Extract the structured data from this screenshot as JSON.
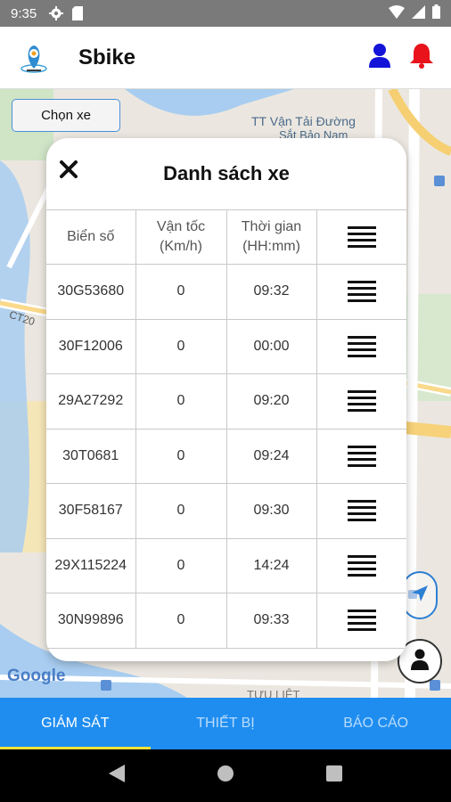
{
  "status_bar": {
    "time": "9:35"
  },
  "app_bar": {
    "title": "Sbike"
  },
  "map": {
    "choose_button": "Chọn xe",
    "labels": [
      "TT Vận Tải Đường",
      "Sắt Bảo Nam",
      "CT20",
      "TỰU LIỆT"
    ],
    "attribution": "Google"
  },
  "dialog": {
    "title": "Danh sách xe",
    "headers": {
      "plate": "Biển số",
      "speed_line1": "Vận tốc",
      "speed_line2": "(Km/h)",
      "time_line1": "Thời gian",
      "time_line2": "(HH:mm)"
    },
    "rows": [
      {
        "plate": "30G53680",
        "speed": "0",
        "time": "09:32"
      },
      {
        "plate": "30F12006",
        "speed": "0",
        "time": "00:00"
      },
      {
        "plate": "29A27292",
        "speed": "0",
        "time": "09:20"
      },
      {
        "plate": "30T0681",
        "speed": "0",
        "time": "09:24"
      },
      {
        "plate": "30F58167",
        "speed": "0",
        "time": "09:30"
      },
      {
        "plate": "29X115224",
        "speed": "0",
        "time": "14:24"
      },
      {
        "plate": "30N99896",
        "speed": "0",
        "time": "09:33"
      }
    ]
  },
  "tabs": [
    {
      "label": "GIÁM SÁT",
      "active": true
    },
    {
      "label": "THIẾT BỊ",
      "active": false
    },
    {
      "label": "BÁO CÁO",
      "active": false
    }
  ],
  "colors": {
    "accent": "#1f8df0",
    "tab_indicator": "#f2e23a",
    "user_icon": "#1414d8",
    "bell_icon": "#e8131b"
  },
  "icons": [
    "settings-icon",
    "sd-card-icon",
    "wifi-icon",
    "signal-icon",
    "battery-icon",
    "user-icon",
    "bell-icon",
    "close-icon",
    "menu-icon",
    "location-arrow-icon",
    "person-icon",
    "back-icon",
    "home-icon",
    "recents-icon"
  ]
}
